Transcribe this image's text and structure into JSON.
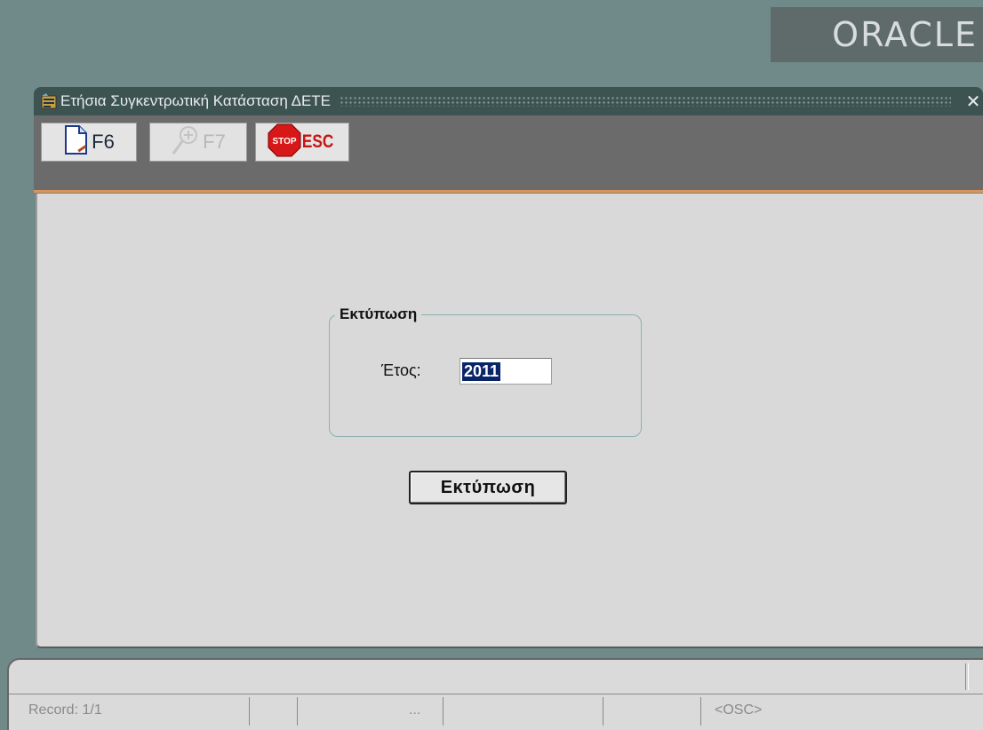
{
  "brand": {
    "logo_text": "ORACLE"
  },
  "window": {
    "title": "Ετήσια Συγκεντρωτική Κατάσταση ΔΕΤΕ",
    "close_symbol": "✕"
  },
  "toolbar": {
    "buttons": [
      {
        "key": "F6",
        "icon": "new-document-icon",
        "enabled": true
      },
      {
        "key": "F7",
        "icon": "zoom-in-icon",
        "enabled": false
      },
      {
        "key": "ESC",
        "icon": "stop-sign-icon",
        "enabled": true,
        "icon_text": "STOP"
      }
    ]
  },
  "form": {
    "frame_title": "Εκτύπωση",
    "year_label": "Έτος:",
    "year_value": "2011",
    "print_button": "Εκτύπωση"
  },
  "statusbar": {
    "record": "Record: 1/1",
    "ellipsis": "...",
    "mode": "<OSC>"
  },
  "colors": {
    "desktop": "#6f8a88",
    "titlebar": "#3d5352",
    "toolbar": "#6b6b6b",
    "toolbar_accent": "#d9935b",
    "canvas": "#d9d9d9",
    "selection": "#0a246a"
  }
}
